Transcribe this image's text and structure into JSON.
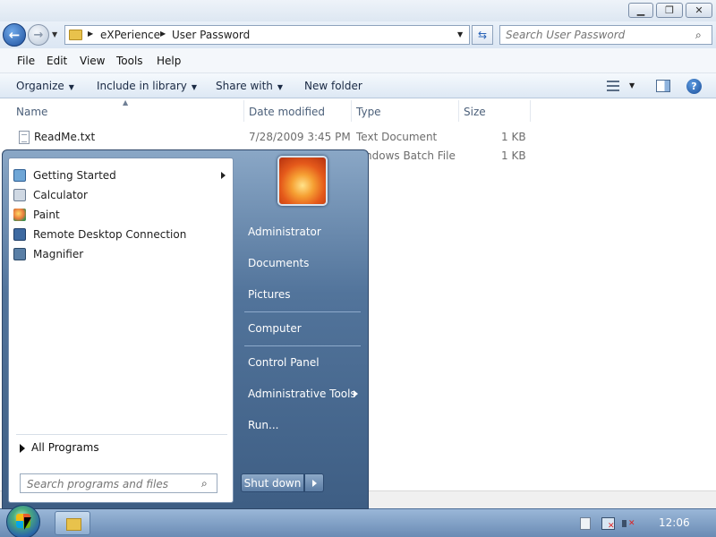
{
  "window": {
    "breadcrumb": [
      "eXPerience",
      "User Password"
    ],
    "search_placeholder": "Search User Password"
  },
  "menu": [
    "File",
    "Edit",
    "View",
    "Tools",
    "Help"
  ],
  "toolbar": {
    "organize": "Organize",
    "include_in_library": "Include in library",
    "share_with": "Share with",
    "new_folder": "New folder"
  },
  "columns": [
    "Name",
    "Date modified",
    "Type",
    "Size"
  ],
  "files": [
    {
      "name": "ReadMe.txt",
      "date": "7/28/2009 3:45 PM",
      "type": "Text Document",
      "size": "1 KB"
    },
    {
      "name": "",
      "date": "",
      "type": "ndows Batch File",
      "size": "1 KB"
    }
  ],
  "start_menu": {
    "programs": [
      "Getting Started",
      "Calculator",
      "Paint",
      "Remote Desktop Connection",
      "Magnifier"
    ],
    "all_programs": "All Programs",
    "search_placeholder": "Search programs and files",
    "right_items": [
      "Administrator",
      "Documents",
      "Pictures",
      "Computer",
      "Control Panel",
      "Administrative Tools",
      "Run..."
    ],
    "shutdown": "Shut down"
  },
  "taskbar": {
    "clock": "12:06"
  },
  "icons": {
    "back": "back-arrow-icon",
    "forward": "forward-arrow-icon",
    "refresh": "refresh-icon",
    "search": "search-icon",
    "help": "help-icon",
    "start": "windows-orb-icon"
  },
  "colors": {
    "start_menu": "#52749b",
    "toolbar": "#dde8f4",
    "taskbar": "#6a8bb4"
  }
}
